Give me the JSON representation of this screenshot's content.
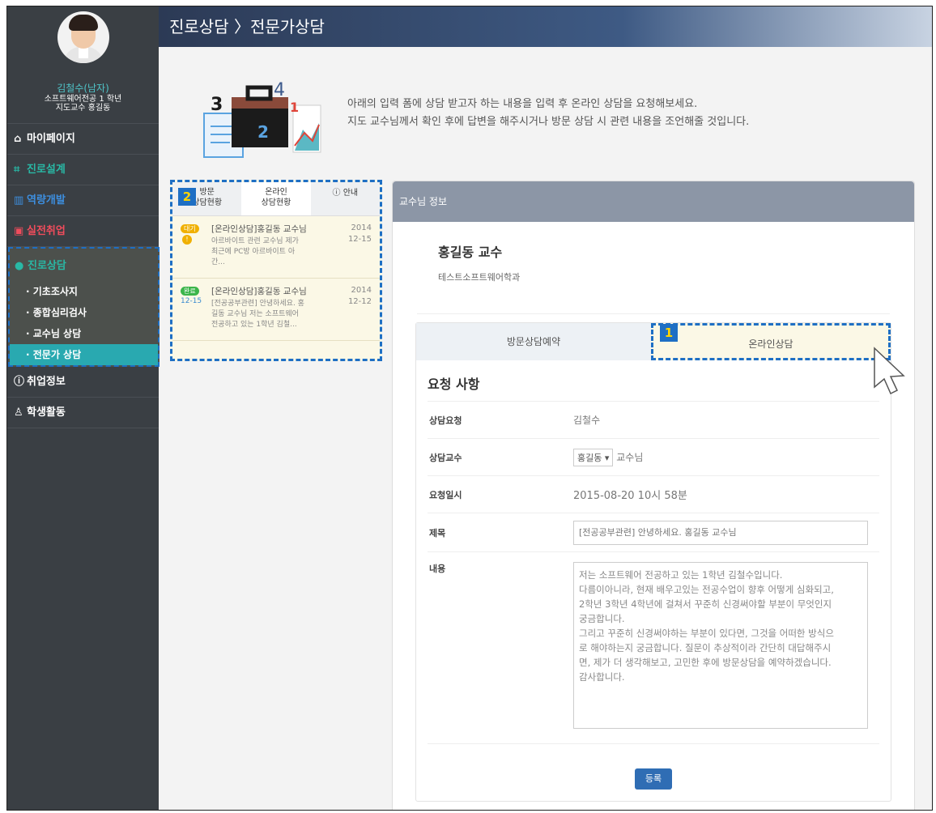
{
  "header": {
    "title": "진로상담 〉전문가상담"
  },
  "profile": {
    "name": "김철수(남자)",
    "line1": "소프트웨어전공 1 학년",
    "line2": "지도교수 홍길동"
  },
  "nav": {
    "items": [
      {
        "label": "마이페이지",
        "icon": "home-icon"
      },
      {
        "label": "진로설계",
        "icon": "chart-icon"
      },
      {
        "label": "역량개발",
        "icon": "bar-chart-icon"
      },
      {
        "label": "실전취업",
        "icon": "briefcase-icon"
      }
    ],
    "group": {
      "label": "진로상담",
      "icon": "chat-icon",
      "subs": [
        "· 기초조사지",
        "· 종합심리검사",
        "· 교수님 상담",
        "· 전문가 상담"
      ]
    },
    "bottom": [
      {
        "label": "취업정보",
        "icon": "info-icon"
      },
      {
        "label": "학생활동",
        "icon": "users-icon"
      }
    ]
  },
  "intro": {
    "line1": "아래의 입력 폼에 상담 받고자 하는 내용을 입력 후 온라인 상담을 요청해보세요.",
    "line2": "지도 교수님께서 확인 후에 답변을 해주시거나 방문 상담 시 관련 내용을 조언해줄 것입니다.",
    "illus_numbers": [
      "3",
      "4",
      "1",
      "2"
    ]
  },
  "left_panel": {
    "badge": "2",
    "tabs": [
      "방문\n상담현황",
      "온라인\n상담현황",
      "ⓘ 안내"
    ],
    "items": [
      {
        "status": "대기",
        "title": "[온라인상담]홍길동 교수님",
        "body": "아르바이트 관련 교수님 제가\n최근에 PC방 아르바이트 아\n간...",
        "date": "2014\n12-15",
        "sub": "!"
      },
      {
        "status": "완료",
        "title": "[온라인상담]홍길동 교수님",
        "body": "[전공공부관련] 안녕하세요. 홍\n길동 교수님 저는 소프트웨어\n전공하고 있는 1학년 김철...",
        "date": "2014\n12-12",
        "sub": "12-15"
      }
    ]
  },
  "card": {
    "header": "교수님 정보",
    "prof_name": "홍길동 교수",
    "prof_dept": "테스트소프트웨어학과",
    "badge": "1",
    "tabs": [
      "방문상담예약",
      "온라인상담"
    ],
    "form_title": "요청 사항",
    "fields": {
      "request_label": "상담요청",
      "request_value": "김철수",
      "prof_label": "상담교수",
      "prof_select": "홍길동",
      "prof_suffix": "교수님",
      "date_label": "요청일시",
      "date_value": "2015-08-20 10시 58분",
      "title_label": "제목",
      "title_value": "[전공공부관련] 안녕하세요. 홍길동 교수님",
      "content_label": "내용",
      "content_value": "저는 소프트웨어 전공하고 있는 1학년 김철수입니다.\n다름이아니라, 현재 배우고있는 전공수업이 향후 어떻게 심화되고,\n2학년 3학년 4학년에 걸쳐서 꾸준히 신경써야할 부분이 무엇인지\n궁금합니다.\n그리고 꾸준히 신경써야하는 부분이 있다면, 그것을 어떠한 방식으\n로 해야하는지 궁금합니다. 질문이 추상적이라 간단히 대답해주시\n면, 제가 더 생각해보고, 고민한 후에 방문상담을 예약하겠습니다.\n감사합니다."
    },
    "submit": "등록"
  },
  "colors": {
    "sidebar": "#3a3f44",
    "accent_teal": "#29b8a5",
    "annotation_blue": "#1e6fc4",
    "annotation_yellow": "#ffd400"
  }
}
